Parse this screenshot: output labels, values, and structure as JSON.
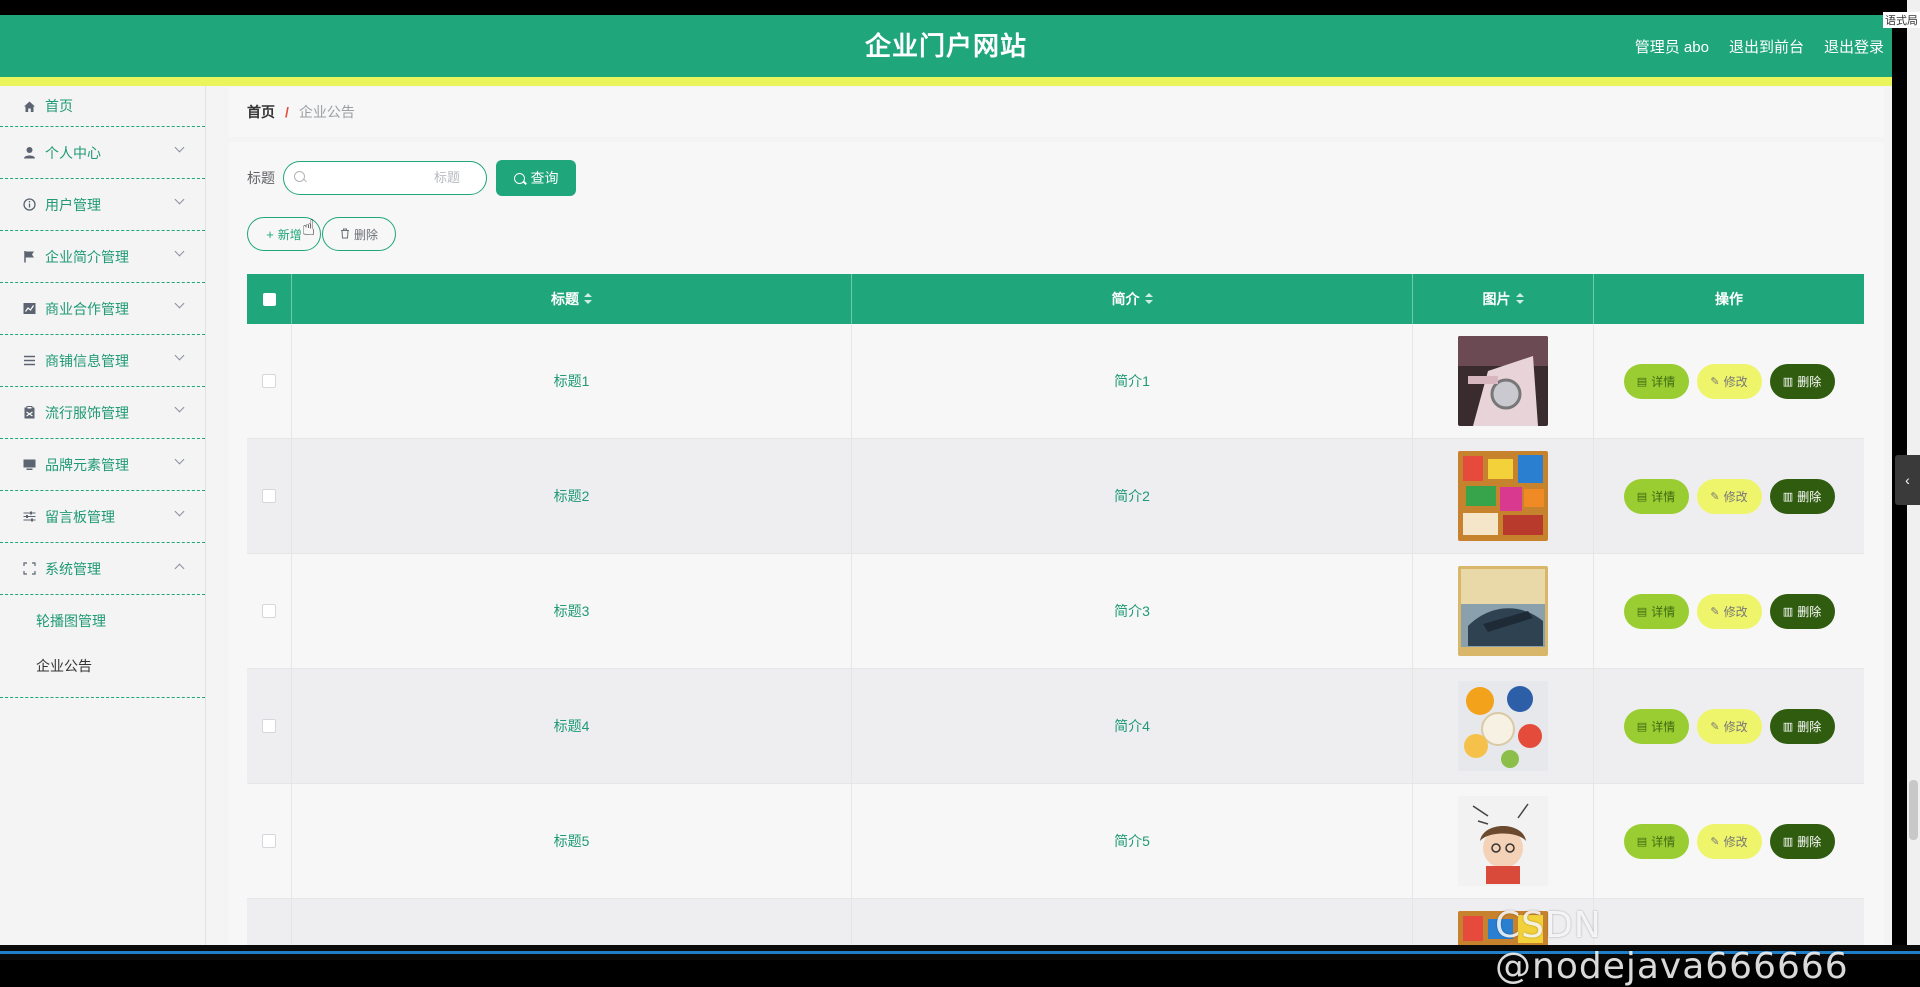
{
  "header": {
    "title": "企业门户网站",
    "admin": "管理员 abo",
    "to_front": "退出到前台",
    "logout": "退出登录"
  },
  "sidebar": {
    "items": [
      {
        "label": "首页",
        "icon": "home-icon"
      },
      {
        "label": "个人中心",
        "icon": "user-icon"
      },
      {
        "label": "用户管理",
        "icon": "info-icon"
      },
      {
        "label": "企业简介管理",
        "icon": "flag-icon"
      },
      {
        "label": "商业合作管理",
        "icon": "chart-icon"
      },
      {
        "label": "商铺信息管理",
        "icon": "list-icon"
      },
      {
        "label": "流行服饰管理",
        "icon": "clipboard-icon"
      },
      {
        "label": "品牌元素管理",
        "icon": "monitor-icon"
      },
      {
        "label": "留言板管理",
        "icon": "sliders-icon"
      },
      {
        "label": "系统管理",
        "icon": "fullscreen-icon"
      }
    ],
    "sub": [
      {
        "label": "轮播图管理"
      },
      {
        "label": "企业公告"
      }
    ]
  },
  "breadcrumb": {
    "home": "首页",
    "separator": "/",
    "current": "企业公告"
  },
  "search": {
    "label": "标题",
    "placeholder": "标题",
    "button": "查询"
  },
  "actions": {
    "add": "新增",
    "delete": "删除"
  },
  "table": {
    "headers": [
      "标题",
      "简介",
      "图片",
      "操作"
    ],
    "rows": [
      {
        "title": "标题1",
        "intro": "简介1"
      },
      {
        "title": "标题2",
        "intro": "简介2"
      },
      {
        "title": "标题3",
        "intro": "简介3"
      },
      {
        "title": "标题4",
        "intro": "简介4"
      },
      {
        "title": "标题5",
        "intro": "简介5"
      }
    ],
    "ops": {
      "detail": "详情",
      "edit": "修改",
      "remove": "删除"
    }
  },
  "corner": "语式局",
  "watermark": "CSDN @nodejava666666",
  "colors": {
    "primary": "#1fa67a",
    "accent_yellow": "#e9f55b",
    "detail_btn": "#9acd32",
    "edit_btn": "#eff56a",
    "delete_btn": "#2f5c0f"
  }
}
